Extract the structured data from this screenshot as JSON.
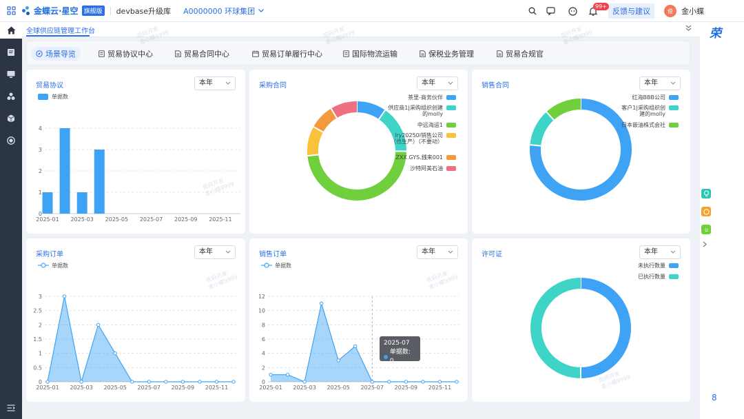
{
  "app": {
    "brand": "金蝶云·星空",
    "edition_badge": "旗舰版",
    "database": "devbase升级库",
    "org": "A0000000 环球集团",
    "feedback": "反馈与建议",
    "notification_count": "99+",
    "avatar_text": "俊",
    "username": "金小蝶"
  },
  "page_tab": "全球供应链管理工作台",
  "nav": [
    {
      "label": "场景导览",
      "icon": "compass-icon",
      "active": true
    },
    {
      "label": "贸易协议中心",
      "icon": "document-icon"
    },
    {
      "label": "贸易合同中心",
      "icon": "document-icon"
    },
    {
      "label": "贸易订单履行中心",
      "icon": "calendar-icon"
    },
    {
      "label": "国际物流运输",
      "icon": "document-icon"
    },
    {
      "label": "保税业务管理",
      "icon": "document-icon"
    },
    {
      "label": "贸易合规官",
      "icon": "document-icon"
    }
  ],
  "right_rail": {
    "logo": "荣",
    "number": "8"
  },
  "watermark": "低码开发\n金小蝶9999",
  "colors": {
    "primary": "#2c6fe5",
    "sidebar": "#2b3544",
    "series_blue": "#3ea3f5",
    "teal": "#3ed5c8",
    "green": "#6fcf3c",
    "yellow": "#f9c13c",
    "orange": "#f49a3c",
    "pink": "#ef6f83"
  },
  "cards": {
    "trade_agreement": {
      "title": "贸易协议",
      "period": "本年"
    },
    "purchase_contract": {
      "title": "采购合同",
      "period": "本年"
    },
    "sales_contract": {
      "title": "销售合同",
      "period": "本年"
    },
    "purchase_order": {
      "title": "采购订单",
      "period": "本年"
    },
    "sales_order": {
      "title": "销售订单",
      "period": "本年",
      "tooltip": {
        "title": "2025-07",
        "text": "单据数: 0"
      }
    },
    "license": {
      "title": "许可证",
      "period": "本年"
    }
  },
  "chart_data": [
    {
      "id": "trade_agreement",
      "type": "bar",
      "series": [
        {
          "name": "单据数",
          "values": [
            1,
            4,
            1,
            3,
            0,
            0,
            0,
            0,
            0,
            0,
            0,
            0
          ]
        }
      ],
      "categories": [
        "2025-01",
        "2025-02",
        "2025-03",
        "2025-04",
        "2025-05",
        "2025-06",
        "2025-07",
        "2025-08",
        "2025-09",
        "2025-10",
        "2025-11",
        "2025-12"
      ],
      "tick_labels": [
        "2025-01",
        "2025-03",
        "2025-05",
        "2025-07",
        "2025-09",
        "2025-11"
      ],
      "ylim": [
        0,
        4
      ],
      "yticks": [
        0,
        1,
        2,
        3,
        4
      ],
      "legend": "top-left"
    },
    {
      "id": "purchase_contract",
      "type": "pie",
      "donut": true,
      "slices": [
        {
          "name": "茶里-商务伙伴",
          "value": 1,
          "color": "#3ea3f5"
        },
        {
          "name": "供应商1|采购组织创建的molly",
          "value": 1.6,
          "color": "#3ed5c8"
        },
        {
          "name": "中远海运1",
          "value": 5,
          "color": "#6fcf3c"
        },
        {
          "name": "lry20250l销售公司（也生产）（不要动）",
          "value": 1,
          "color": "#f9c13c"
        },
        {
          "name": "ZXX.GYS.銭来001",
          "value": 0.85,
          "color": "#f49a3c"
        },
        {
          "name": "沙特阿美石油",
          "value": 0.9,
          "color": "#ef6f83"
        }
      ],
      "legend": "right"
    },
    {
      "id": "sales_contract",
      "type": "pie",
      "donut": true,
      "slices": [
        {
          "name": "红海BBB公司",
          "value": 6.5,
          "color": "#3ea3f5"
        },
        {
          "name": "客户1|采购组织创建的molly",
          "value": 1,
          "color": "#3ed5c8"
        },
        {
          "name": "日本嵌油株式会社",
          "value": 1,
          "color": "#6fcf3c"
        }
      ],
      "legend": "right"
    },
    {
      "id": "purchase_order",
      "type": "area",
      "series": [
        {
          "name": "单据数",
          "values": [
            0,
            3,
            0,
            2,
            1,
            0,
            0,
            0,
            0,
            0,
            0,
            0
          ]
        }
      ],
      "categories": [
        "2025-01",
        "2025-02",
        "2025-03",
        "2025-04",
        "2025-05",
        "2025-06",
        "2025-07",
        "2025-08",
        "2025-09",
        "2025-10",
        "2025-11",
        "2025-12"
      ],
      "tick_labels": [
        "2025-01",
        "2025-03",
        "2025-05",
        "2025-07",
        "2025-09",
        "2025-11"
      ],
      "ylim": [
        0,
        3
      ],
      "yticks": [
        0,
        0.5,
        1,
        1.5,
        2,
        2.5,
        3
      ],
      "legend": "top-left"
    },
    {
      "id": "sales_order",
      "type": "area",
      "series": [
        {
          "name": "单据数",
          "values": [
            1,
            1,
            0,
            11,
            3,
            5,
            0,
            0,
            0,
            0,
            0,
            0
          ]
        }
      ],
      "categories": [
        "2025-01",
        "2025-02",
        "2025-03",
        "2025-04",
        "2025-05",
        "2025-06",
        "2025-07",
        "2025-08",
        "2025-09",
        "2025-10",
        "2025-11",
        "2025-12"
      ],
      "tick_labels": [
        "2025-01",
        "2025-03",
        "2025-05",
        "2025-07",
        "2025-09",
        "2025-11"
      ],
      "ylim": [
        0,
        12
      ],
      "yticks": [
        0,
        2,
        4,
        6,
        8,
        10,
        12
      ],
      "legend": "top-left"
    },
    {
      "id": "license",
      "type": "pie",
      "donut": true,
      "slices": [
        {
          "name": "未执行数量",
          "value": 1,
          "color": "#3ea3f5"
        },
        {
          "name": "已执行数量",
          "value": 1,
          "color": "#3ed5c8"
        }
      ],
      "legend": "right"
    }
  ]
}
